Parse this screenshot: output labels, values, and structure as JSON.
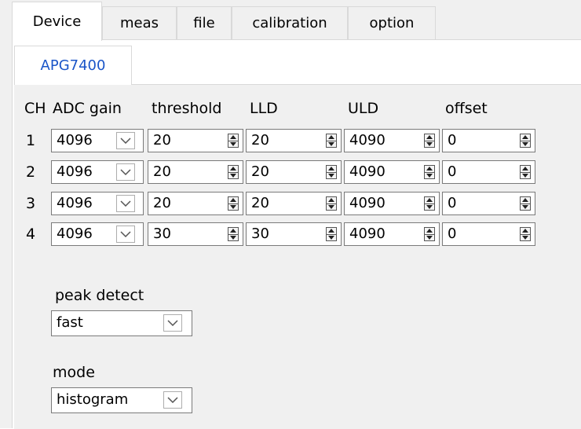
{
  "tabs": [
    "Device",
    "meas",
    "file",
    "calibration",
    "option"
  ],
  "active_tab": "Device",
  "subtab": "APG7400",
  "columns": {
    "ch": "CH",
    "adc_gain": "ADC gain",
    "threshold": "threshold",
    "lld": "LLD",
    "uld": "ULD",
    "offset": "offset"
  },
  "channels": [
    {
      "ch": "1",
      "adc_gain": "4096",
      "threshold": "20",
      "lld": "20",
      "uld": "4090",
      "offset": "0"
    },
    {
      "ch": "2",
      "adc_gain": "4096",
      "threshold": "20",
      "lld": "20",
      "uld": "4090",
      "offset": "0"
    },
    {
      "ch": "3",
      "adc_gain": "4096",
      "threshold": "20",
      "lld": "20",
      "uld": "4090",
      "offset": "0"
    },
    {
      "ch": "4",
      "adc_gain": "4096",
      "threshold": "30",
      "lld": "30",
      "uld": "4090",
      "offset": "0"
    }
  ],
  "peak_detect": {
    "label": "peak detect",
    "value": "fast"
  },
  "mode": {
    "label": "mode",
    "value": "histogram"
  },
  "icons": {
    "combo": "chevron-down-icon",
    "spinner": "spin-updown-icon"
  },
  "colors": {
    "subtab_text": "#1a55c8",
    "panel_bg": "#f0f0f0",
    "field_border": "#7a7a7a"
  }
}
